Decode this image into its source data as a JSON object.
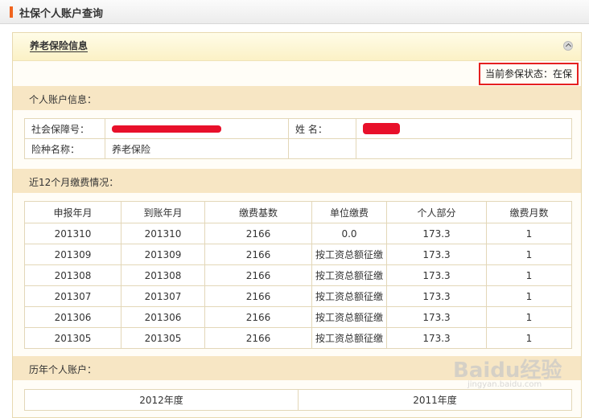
{
  "page": {
    "title": "社保个人账户查询"
  },
  "panel": {
    "header": "养老保险信息"
  },
  "status": {
    "label": "当前参保状态：",
    "value": "在保"
  },
  "account_info": {
    "section_title": "个人账户信息：",
    "ssn_label": "社会保障号：",
    "name_label": "姓    名：",
    "insurance_label": "险种名称：",
    "insurance_value": "养老保险"
  },
  "payments": {
    "section_title": "近12个月缴费情况：",
    "columns": [
      "申报年月",
      "到账年月",
      "缴费基数",
      "单位缴费",
      "个人部分",
      "缴费月数"
    ],
    "rows": [
      [
        "201310",
        "201310",
        "2166",
        "0.0",
        "173.3",
        "1"
      ],
      [
        "201309",
        "201309",
        "2166",
        "按工资总额征缴",
        "173.3",
        "1"
      ],
      [
        "201308",
        "201308",
        "2166",
        "按工资总额征缴",
        "173.3",
        "1"
      ],
      [
        "201307",
        "201307",
        "2166",
        "按工资总额征缴",
        "173.3",
        "1"
      ],
      [
        "201306",
        "201306",
        "2166",
        "按工资总额征缴",
        "173.3",
        "1"
      ],
      [
        "201305",
        "201305",
        "2166",
        "按工资总额征缴",
        "173.3",
        "1"
      ]
    ]
  },
  "history": {
    "section_title": "历年个人账户：",
    "years": [
      "2012年度",
      "2011年度"
    ]
  },
  "watermark": {
    "brand": "Baidu经验",
    "url": "jingyan.baidu.com"
  },
  "colors": {
    "accent": "#f0641e",
    "status_border": "#e52020",
    "section_bg": "#f7e6c4",
    "redaction": "#e8102a"
  }
}
